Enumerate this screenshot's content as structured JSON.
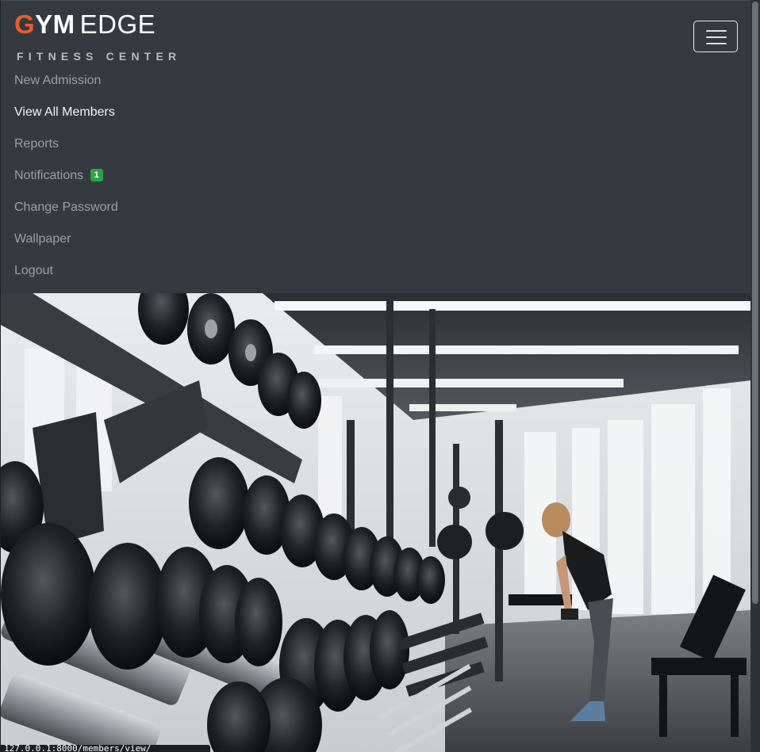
{
  "brand": {
    "g": "G",
    "ym": "YM",
    "edge": "EDGE",
    "subtitle": "FITNESS CENTER"
  },
  "nav": {
    "toggler_icon": "hamburger-menu-icon",
    "items": [
      {
        "label": "New Admission",
        "active": false
      },
      {
        "label": "View All Members",
        "active": true
      },
      {
        "label": "Reports",
        "active": false
      },
      {
        "label": "Notifications",
        "active": false,
        "badge": "1"
      },
      {
        "label": "Change Password",
        "active": false
      },
      {
        "label": "Wallpaper",
        "active": false
      },
      {
        "label": "Logout",
        "active": false
      }
    ]
  },
  "hero": {
    "image": "gym-dumbbell-rack-photo"
  },
  "status_bar": {
    "url": "127.0.0.1:8000/members/view/"
  },
  "colors": {
    "navbar_bg": "#343a40",
    "brand_accent": "#f05a28",
    "badge_green": "#28a745",
    "nav_text": "#9aa0a6",
    "nav_text_active": "#f1f3f5"
  }
}
